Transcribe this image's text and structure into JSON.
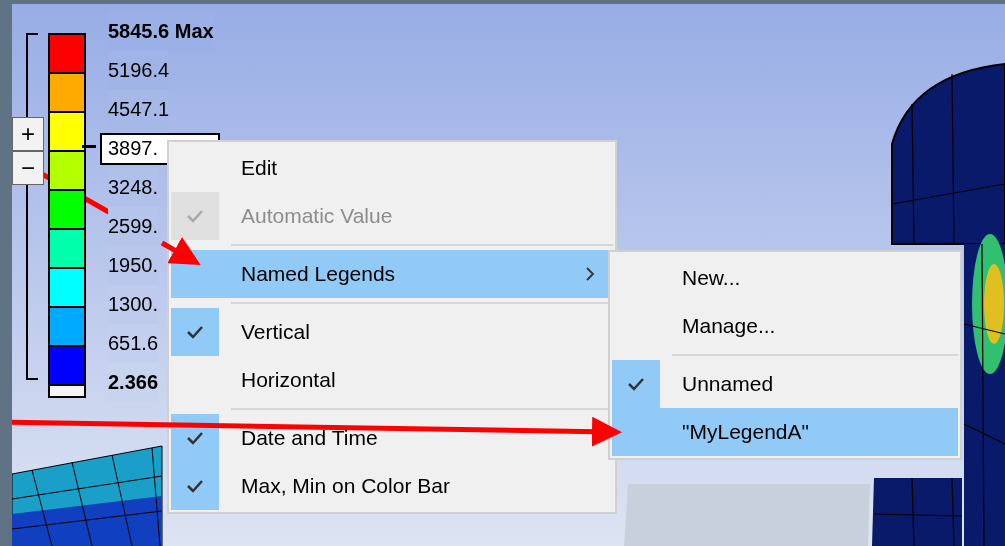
{
  "legend": {
    "labels": [
      {
        "kind": "max",
        "text": "5845.6 Max"
      },
      {
        "kind": "plain",
        "text": "5196.4"
      },
      {
        "kind": "plain",
        "text": "4547.1"
      },
      {
        "kind": "field",
        "text": "3897."
      },
      {
        "kind": "plain",
        "text": "3248."
      },
      {
        "kind": "plain",
        "text": "2599."
      },
      {
        "kind": "plain",
        "text": "1950."
      },
      {
        "kind": "plain",
        "text": "1300."
      },
      {
        "kind": "plain",
        "text": "651.6"
      },
      {
        "kind": "min",
        "text": "2.366"
      }
    ],
    "bands": [
      {
        "color": "#ff0000"
      },
      {
        "color": "#ffaa00"
      },
      {
        "color": "#ffff00"
      },
      {
        "color": "#b4ff00"
      },
      {
        "color": "#00ff00"
      },
      {
        "color": "#00ffaa"
      },
      {
        "color": "#00ffff"
      },
      {
        "color": "#00aaff"
      },
      {
        "color": "#0000ff"
      },
      {
        "color": "#f4f4f4"
      }
    ],
    "buttons": [
      "+",
      "−"
    ]
  },
  "context_menu": {
    "items": [
      {
        "kind": "item",
        "label": "Edit",
        "checked": false,
        "disabled": false,
        "selected": false,
        "submenu": false
      },
      {
        "kind": "item",
        "label": "Automatic Value",
        "checked": true,
        "disabled": true,
        "selected": false,
        "submenu": false
      },
      {
        "kind": "separator"
      },
      {
        "kind": "item",
        "label": "Named Legends",
        "checked": false,
        "disabled": false,
        "selected": true,
        "submenu": true
      },
      {
        "kind": "separator"
      },
      {
        "kind": "item",
        "label": "Vertical",
        "checked": true,
        "disabled": false,
        "selected": false,
        "submenu": false
      },
      {
        "kind": "item",
        "label": "Horizontal",
        "checked": false,
        "disabled": false,
        "selected": false,
        "submenu": false
      },
      {
        "kind": "separator"
      },
      {
        "kind": "item",
        "label": "Date and Time",
        "checked": true,
        "disabled": false,
        "selected": false,
        "submenu": false
      },
      {
        "kind": "item",
        "label": "Max, Min on Color Bar",
        "checked": true,
        "disabled": false,
        "selected": false,
        "submenu": false
      }
    ]
  },
  "submenu": {
    "items": [
      {
        "kind": "item",
        "label": "New...",
        "checked": false,
        "disabled": false,
        "selected": false
      },
      {
        "kind": "item",
        "label": "Manage...",
        "checked": false,
        "disabled": false,
        "selected": false
      },
      {
        "kind": "separator"
      },
      {
        "kind": "item",
        "label": "Unnamed",
        "checked": true,
        "disabled": false,
        "selected": false
      },
      {
        "kind": "item",
        "label": "\"MyLegendA\"",
        "checked": false,
        "disabled": false,
        "selected": true
      }
    ]
  }
}
